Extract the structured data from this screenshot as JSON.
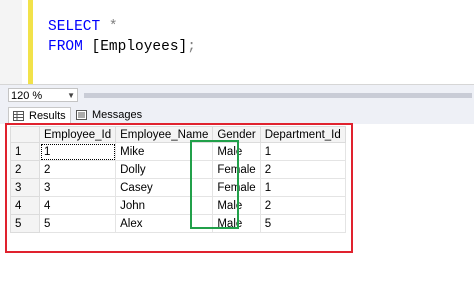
{
  "editor": {
    "line1_keyword": "SELECT",
    "line1_star": "*",
    "line2_keyword": "FROM",
    "line2_table": "[Employees]",
    "line2_semicolon": ";"
  },
  "zoom": {
    "value": "120 %"
  },
  "tabs": [
    {
      "label": "Results",
      "icon": "grid-icon"
    },
    {
      "label": "Messages",
      "icon": "messages-icon"
    }
  ],
  "grid": {
    "columns": [
      "",
      "Employee_Id",
      "Employee_Name",
      "Gender",
      "Department_Id"
    ],
    "rows": [
      [
        "1",
        "1",
        "Mike",
        "Male",
        "1"
      ],
      [
        "2",
        "2",
        "Dolly",
        "Female",
        "2"
      ],
      [
        "3",
        "3",
        "Casey",
        "Female",
        "1"
      ],
      [
        "4",
        "4",
        "John",
        "Male",
        "2"
      ],
      [
        "5",
        "5",
        "Alex",
        "Male",
        "5"
      ]
    ]
  },
  "colors": {
    "highlight_red": "#e0222e",
    "highlight_green": "#21a04a",
    "keyword": "#0000ff"
  }
}
